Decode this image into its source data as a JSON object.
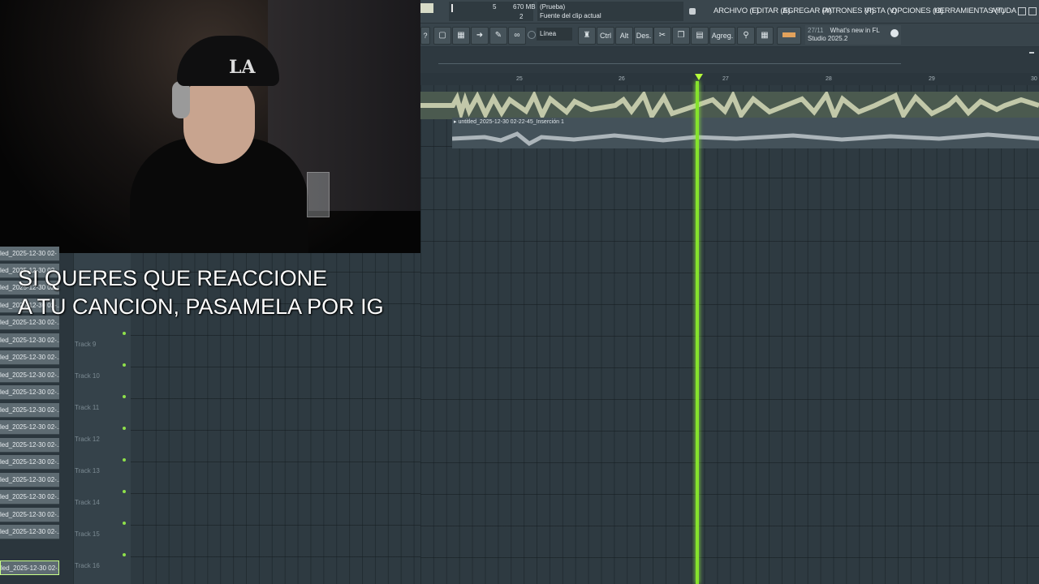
{
  "overlay": {
    "line1": "SI QUERES QUE REACCIONE",
    "line2": "A TU CANCION, PASAMELA POR IG"
  },
  "status": {
    "cpu": "5",
    "memory": "670 MB",
    "polyphony": "2",
    "hint_line1": "(Prueba)",
    "hint_line2": "Fuente del clip actual"
  },
  "menu": {
    "items": [
      "ARCHIVO (F)",
      "EDITAR (E)",
      "AGREGAR (A)",
      "PATRONES (P)",
      "VISTA (V)",
      "OPCIONES (O)",
      "HERRAMIENTAS (T)",
      "AYUDA"
    ]
  },
  "toolbar": {
    "help": "?",
    "snap": "Línea",
    "ctrl": "Ctrl",
    "alt": "Alt",
    "des": "Des.",
    "agreg": "Agreg."
  },
  "news": {
    "count": "27/11",
    "title": "What's new in FL",
    "subtitle": "Studio 2025.2"
  },
  "ruler": {
    "bars": [
      "25",
      "26",
      "27",
      "28",
      "29",
      "30"
    ]
  },
  "clip2": {
    "title": "untitled_2025-12-30 02-22-45_Inserción 1"
  },
  "patterns": [
    "led_2025-12-30 02-",
    "led_2025-12-30 02-..",
    "led_2025-12-30 02-..",
    "led_2025-12-30 02-..",
    "led_2025-12-30 02-..",
    "led_2025-12-30 02-..",
    "led_2025-12-30 02-..",
    "led_2025-12-30 02-..",
    "led_2025-12-30 02-..",
    "led_2025-12-30 02-..",
    "led_2025-12-30 02-..",
    "led_2025-12-30 02-..",
    "led_2025-12-30 02-..",
    "led_2025-12-30 02-..",
    "led_2025-12-30 02-..",
    "led_2025-12-30 02-..",
    "led_2025-12-30 02-..",
    "led_2025-12-30 02-.."
  ],
  "tracks": [
    "Track 9",
    "Track 10",
    "Track 11",
    "Track 12",
    "Track 13",
    "Track 14",
    "Track 15",
    "Track 16"
  ],
  "webcam": {
    "cap_logo": "LA"
  }
}
